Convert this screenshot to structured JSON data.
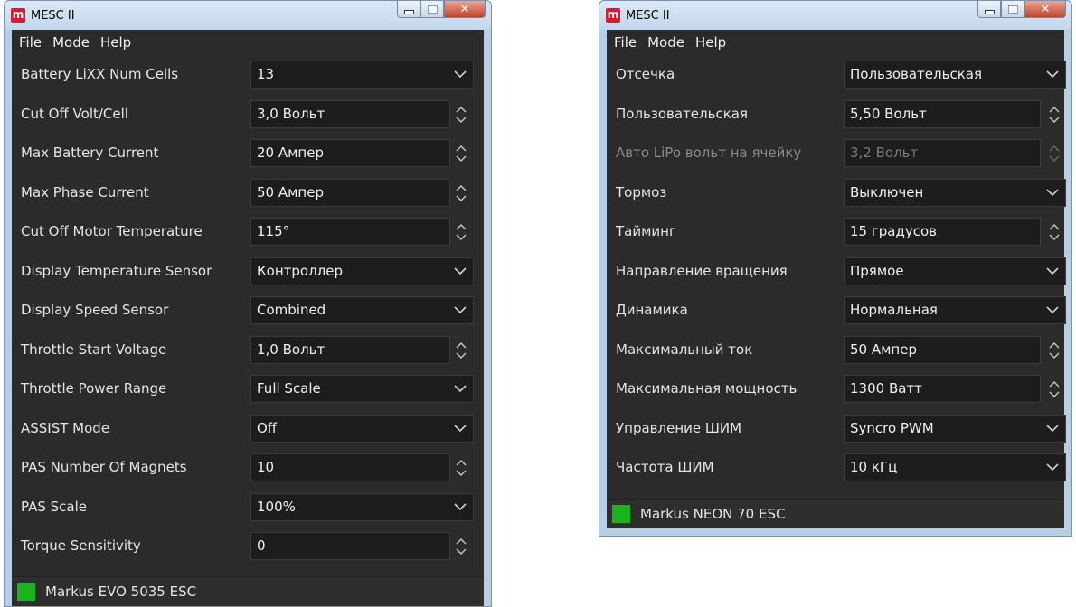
{
  "left": {
    "title": "MESC II",
    "app_icon": "m",
    "menu": [
      "File",
      "Mode",
      "Help"
    ],
    "rows": [
      {
        "label": "Battery LiXX Num Cells",
        "value": "13",
        "control": "combo"
      },
      {
        "label": "Cut Off Volt/Cell",
        "value": "3,0 Вольт",
        "control": "spin"
      },
      {
        "label": "Max Battery Current",
        "value": "20 Ампер",
        "control": "spin"
      },
      {
        "label": "Max Phase Current",
        "value": "50 Ампер",
        "control": "spin"
      },
      {
        "label": "Cut Off Motor Temperature",
        "value": "115°",
        "control": "spin"
      },
      {
        "label": "Display Temperature Sensor",
        "value": "Контроллер",
        "control": "combo"
      },
      {
        "label": "Display Speed Sensor",
        "value": "Combined",
        "control": "combo"
      },
      {
        "label": "Throttle Start Voltage",
        "value": "1,0 Вольт",
        "control": "spin"
      },
      {
        "label": "Throttle Power Range",
        "value": "Full Scale",
        "control": "combo"
      },
      {
        "label": "ASSIST Mode",
        "value": "Off",
        "control": "combo"
      },
      {
        "label": "PAS Number Of Magnets",
        "value": "10",
        "control": "spin"
      },
      {
        "label": "PAS Scale",
        "value": "100%",
        "control": "combo"
      },
      {
        "label": "Torque Sensitivity",
        "value": "0",
        "control": "spin"
      }
    ],
    "status": {
      "text": "Markus EVO 5035 ESC",
      "color": "#1bb31b"
    }
  },
  "right": {
    "title": "MESC II",
    "app_icon": "m",
    "menu": [
      "File",
      "Mode",
      "Help"
    ],
    "rows": [
      {
        "label": "Отсечка",
        "value": "Пользовательская",
        "control": "combo"
      },
      {
        "label": "Пользовательская",
        "value": "5,50 Вольт",
        "control": "spin"
      },
      {
        "label": "Авто LiPo вольт на ячейку",
        "value": "3,2 Вольт",
        "control": "spin",
        "disabled": true
      },
      {
        "label": "Тормоз",
        "value": "Выключен",
        "control": "combo"
      },
      {
        "label": "Тайминг",
        "value": "15 градусов",
        "control": "spin"
      },
      {
        "label": "Направление вращения",
        "value": "Прямое",
        "control": "combo"
      },
      {
        "label": "Динамика",
        "value": "Нормальная",
        "control": "combo"
      },
      {
        "label": "Максимальный ток",
        "value": "50 Ампер",
        "control": "spin"
      },
      {
        "label": "Максимальная мощность",
        "value": "1300 Ватт",
        "control": "spin"
      },
      {
        "label": "Управление ШИМ",
        "value": "Syncro PWM",
        "control": "combo"
      },
      {
        "label": "Частота ШИМ",
        "value": "10 кГц",
        "control": "combo"
      }
    ],
    "status": {
      "text": "Markus NEON 70 ESC",
      "color": "#1bb31b"
    }
  },
  "icons": {
    "combo": "chevron-down-icon",
    "spin": "spin-arrows-icon",
    "close": "close-icon",
    "minimize": "minimize-icon",
    "maximize": "maximize-icon"
  },
  "colors": {
    "client_bg": "#2b2b2b",
    "field_bg": "#1d1d1d",
    "titlebar": "#c3d7ec",
    "close_button": "#c4432b",
    "app_icon": "#d81b30"
  }
}
